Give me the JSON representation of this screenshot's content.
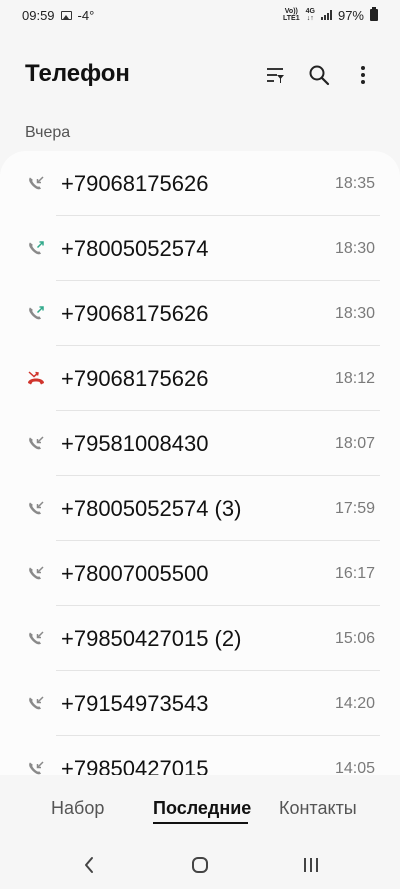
{
  "status_bar": {
    "time": "09:59",
    "temperature": "-4°",
    "volte": "Vo))",
    "lte": "LTE1",
    "network": "4G",
    "battery": "97%"
  },
  "header": {
    "title": "Телефон",
    "icons": [
      "filter-icon",
      "search-icon",
      "more-icon"
    ]
  },
  "section_label": "Вчера",
  "calls": [
    {
      "number": "+79068175626",
      "time": "18:35",
      "type": "incoming"
    },
    {
      "number": "+78005052574",
      "time": "18:30",
      "type": "outgoing"
    },
    {
      "number": "+79068175626",
      "time": "18:30",
      "type": "outgoing"
    },
    {
      "number": "+79068175626",
      "time": "18:12",
      "type": "missed"
    },
    {
      "number": "+79581008430",
      "time": "18:07",
      "type": "incoming"
    },
    {
      "number": "+78005052574 (3)",
      "time": "17:59",
      "type": "incoming"
    },
    {
      "number": "+78007005500",
      "time": "16:17",
      "type": "incoming"
    },
    {
      "number": "+79850427015 (2)",
      "time": "15:06",
      "type": "incoming"
    },
    {
      "number": "+79154973543",
      "time": "14:20",
      "type": "incoming"
    },
    {
      "number": "+79850427015",
      "time": "14:05",
      "type": "incoming"
    }
  ],
  "tabs": [
    {
      "label": "Набор",
      "active": false
    },
    {
      "label": "Последние",
      "active": true
    },
    {
      "label": "Контакты",
      "active": false
    }
  ],
  "colors": {
    "incoming": "#8a8a8a",
    "outgoing": "#2fa88a",
    "missed": "#d0342c"
  }
}
